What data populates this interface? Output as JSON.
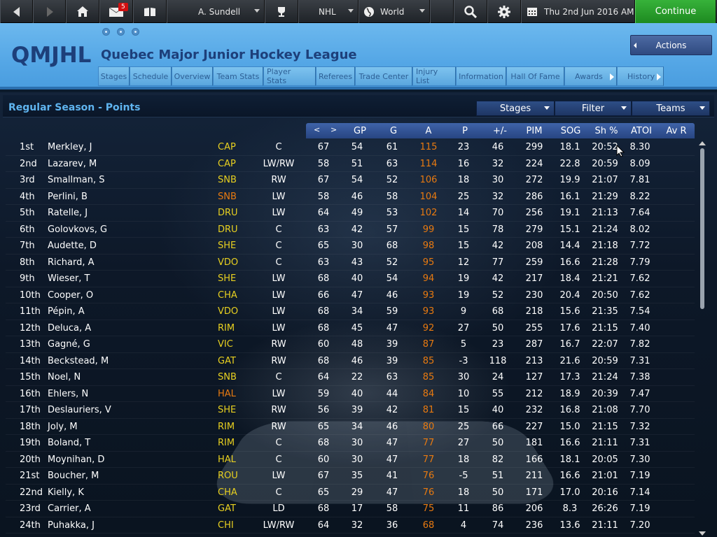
{
  "topbar": {
    "mail_count": "5",
    "manager": "A. Sundell",
    "league": "NHL",
    "region": "World",
    "date": "Thu 2nd Jun 2016 AM",
    "continue_label": "Continue"
  },
  "header": {
    "abbr": "QMJHL",
    "title": "Quebec Major Junior Hockey League",
    "actions_label": "Actions",
    "tabs": [
      "Stages",
      "Schedule",
      "Overview",
      "Team Stats",
      "Player Stats",
      "Referees",
      "Trade Center",
      "Injury List",
      "Information",
      "Hall Of Fame",
      "Awards",
      "History"
    ]
  },
  "panel": {
    "title": "Regular Season - Points",
    "filters": {
      "stages": "Stages",
      "filter": "Filter",
      "teams": "Teams"
    }
  },
  "table": {
    "columns": [
      "GP",
      "G",
      "A",
      "P",
      "+/-",
      "PIM",
      "SOG",
      "Sh %",
      "ATOI",
      "Av R"
    ],
    "prev": "<",
    "next": ">",
    "rows": [
      {
        "rank": "1st",
        "name": "Merkley, J",
        "team": "CAP",
        "pos": "C",
        "gp": "67",
        "g": "54",
        "a": "61",
        "p": "115",
        "pm": "23",
        "pim": "46",
        "sog": "299",
        "sh": "18.1",
        "atoi": "20:52",
        "avr": "8.30"
      },
      {
        "rank": "2nd",
        "name": "Lazarev, M",
        "team": "CAP",
        "pos": "LW/RW",
        "gp": "58",
        "g": "51",
        "a": "63",
        "p": "114",
        "pm": "16",
        "pim": "32",
        "sog": "224",
        "sh": "22.8",
        "atoi": "20:59",
        "avr": "8.09"
      },
      {
        "rank": "3rd",
        "name": "Smallman, S",
        "team": "SNB",
        "pos": "RW",
        "gp": "67",
        "g": "54",
        "a": "52",
        "p": "106",
        "pm": "18",
        "pim": "30",
        "sog": "272",
        "sh": "19.9",
        "atoi": "21:07",
        "avr": "7.81"
      },
      {
        "rank": "4th",
        "name": "Perlini, B",
        "team": "SNB",
        "pos": "LW",
        "gp": "58",
        "g": "46",
        "a": "58",
        "p": "104",
        "pm": "25",
        "pim": "32",
        "sog": "286",
        "sh": "16.1",
        "atoi": "21:29",
        "avr": "8.22"
      },
      {
        "rank": "5th",
        "name": "Ratelle, J",
        "team": "DRU",
        "pos": "LW",
        "gp": "64",
        "g": "49",
        "a": "53",
        "p": "102",
        "pm": "14",
        "pim": "70",
        "sog": "256",
        "sh": "19.1",
        "atoi": "21:13",
        "avr": "7.64"
      },
      {
        "rank": "6th",
        "name": "Golovkovs, G",
        "team": "DRU",
        "pos": "C",
        "gp": "63",
        "g": "42",
        "a": "57",
        "p": "99",
        "pm": "15",
        "pim": "78",
        "sog": "279",
        "sh": "15.1",
        "atoi": "21:24",
        "avr": "8.02"
      },
      {
        "rank": "7th",
        "name": "Audette, D",
        "team": "SHE",
        "pos": "C",
        "gp": "65",
        "g": "30",
        "a": "68",
        "p": "98",
        "pm": "15",
        "pim": "42",
        "sog": "208",
        "sh": "14.4",
        "atoi": "21:18",
        "avr": "7.72"
      },
      {
        "rank": "8th",
        "name": "Richard, A",
        "team": "VDO",
        "pos": "C",
        "gp": "63",
        "g": "43",
        "a": "52",
        "p": "95",
        "pm": "12",
        "pim": "77",
        "sog": "259",
        "sh": "16.6",
        "atoi": "21:28",
        "avr": "7.79"
      },
      {
        "rank": "9th",
        "name": "Wieser, T",
        "team": "SHE",
        "pos": "LW",
        "gp": "68",
        "g": "40",
        "a": "54",
        "p": "94",
        "pm": "19",
        "pim": "42",
        "sog": "217",
        "sh": "18.4",
        "atoi": "21:21",
        "avr": "7.62"
      },
      {
        "rank": "10th",
        "name": "Cooper, O",
        "team": "CHA",
        "pos": "LW",
        "gp": "66",
        "g": "47",
        "a": "46",
        "p": "93",
        "pm": "19",
        "pim": "52",
        "sog": "230",
        "sh": "20.4",
        "atoi": "20:50",
        "avr": "7.62"
      },
      {
        "rank": "11th",
        "name": "Pépin, A",
        "team": "VDO",
        "pos": "LW",
        "gp": "68",
        "g": "34",
        "a": "59",
        "p": "93",
        "pm": "9",
        "pim": "68",
        "sog": "218",
        "sh": "15.6",
        "atoi": "21:35",
        "avr": "7.54"
      },
      {
        "rank": "12th",
        "name": "Deluca, A",
        "team": "RIM",
        "pos": "LW",
        "gp": "68",
        "g": "45",
        "a": "47",
        "p": "92",
        "pm": "27",
        "pim": "50",
        "sog": "255",
        "sh": "17.6",
        "atoi": "21:15",
        "avr": "7.40"
      },
      {
        "rank": "13th",
        "name": "Gagné, G",
        "team": "VIC",
        "pos": "RW",
        "gp": "60",
        "g": "48",
        "a": "39",
        "p": "87",
        "pm": "5",
        "pim": "23",
        "sog": "287",
        "sh": "16.7",
        "atoi": "22:07",
        "avr": "7.82"
      },
      {
        "rank": "14th",
        "name": "Beckstead, M",
        "team": "GAT",
        "pos": "RW",
        "gp": "68",
        "g": "46",
        "a": "39",
        "p": "85",
        "pm": "-3",
        "pim": "118",
        "sog": "213",
        "sh": "21.6",
        "atoi": "20:59",
        "avr": "7.31"
      },
      {
        "rank": "15th",
        "name": "Noel, N",
        "team": "SNB",
        "pos": "C",
        "gp": "64",
        "g": "22",
        "a": "63",
        "p": "85",
        "pm": "30",
        "pim": "24",
        "sog": "127",
        "sh": "17.3",
        "atoi": "21:24",
        "avr": "7.38"
      },
      {
        "rank": "16th",
        "name": "Ehlers, N",
        "team": "HAL",
        "pos": "LW",
        "gp": "59",
        "g": "40",
        "a": "44",
        "p": "84",
        "pm": "10",
        "pim": "55",
        "sog": "212",
        "sh": "18.9",
        "atoi": "20:39",
        "avr": "7.47"
      },
      {
        "rank": "17th",
        "name": "Deslauriers, V",
        "team": "SHE",
        "pos": "RW",
        "gp": "56",
        "g": "39",
        "a": "42",
        "p": "81",
        "pm": "15",
        "pim": "40",
        "sog": "232",
        "sh": "16.8",
        "atoi": "21:08",
        "avr": "7.70"
      },
      {
        "rank": "18th",
        "name": "Joly, M",
        "team": "RIM",
        "pos": "RW",
        "gp": "65",
        "g": "34",
        "a": "46",
        "p": "80",
        "pm": "25",
        "pim": "66",
        "sog": "227",
        "sh": "15.0",
        "atoi": "21:15",
        "avr": "7.32"
      },
      {
        "rank": "19th",
        "name": "Boland, T",
        "team": "RIM",
        "pos": "C",
        "gp": "68",
        "g": "30",
        "a": "47",
        "p": "77",
        "pm": "27",
        "pim": "50",
        "sog": "181",
        "sh": "16.6",
        "atoi": "21:11",
        "avr": "7.31"
      },
      {
        "rank": "20th",
        "name": "Moynihan, D",
        "team": "HAL",
        "pos": "C",
        "gp": "60",
        "g": "30",
        "a": "47",
        "p": "77",
        "pm": "18",
        "pim": "82",
        "sog": "166",
        "sh": "18.1",
        "atoi": "20:05",
        "avr": "7.30"
      },
      {
        "rank": "21st",
        "name": "Boucher, M",
        "team": "ROU",
        "pos": "LW",
        "gp": "67",
        "g": "35",
        "a": "41",
        "p": "76",
        "pm": "-5",
        "pim": "51",
        "sog": "211",
        "sh": "16.6",
        "atoi": "21:01",
        "avr": "7.19"
      },
      {
        "rank": "22nd",
        "name": "Kielly, K",
        "team": "CHA",
        "pos": "C",
        "gp": "65",
        "g": "29",
        "a": "47",
        "p": "76",
        "pm": "18",
        "pim": "50",
        "sog": "171",
        "sh": "17.0",
        "atoi": "20:16",
        "avr": "7.14"
      },
      {
        "rank": "23rd",
        "name": "Carrier, A",
        "team": "GAT",
        "pos": "LD",
        "gp": "68",
        "g": "17",
        "a": "58",
        "p": "75",
        "pm": "11",
        "pim": "86",
        "sog": "206",
        "sh": "8.3",
        "atoi": "26:26",
        "avr": "7.19"
      },
      {
        "rank": "24th",
        "name": "Puhakka, J",
        "team": "CHI",
        "pos": "LW/RW",
        "gp": "64",
        "g": "32",
        "a": "36",
        "p": "68",
        "pm": "4",
        "pim": "74",
        "sog": "236",
        "sh": "13.6",
        "atoi": "21:11",
        "avr": "7.20"
      }
    ]
  },
  "colors": {
    "team_default": "#e8d020",
    "team_orange": "#e87a10",
    "points": "#e87a10",
    "text": "#ffffff",
    "title_blue": "#5fb4ef",
    "continue_green": "#2aa02d"
  },
  "icons": [
    "back-arrow-icon",
    "forward-arrow-icon",
    "home-icon",
    "mail-icon",
    "book-icon",
    "trophy-icon",
    "globe-icon",
    "search-icon",
    "gear-icon",
    "calendar-icon"
  ]
}
